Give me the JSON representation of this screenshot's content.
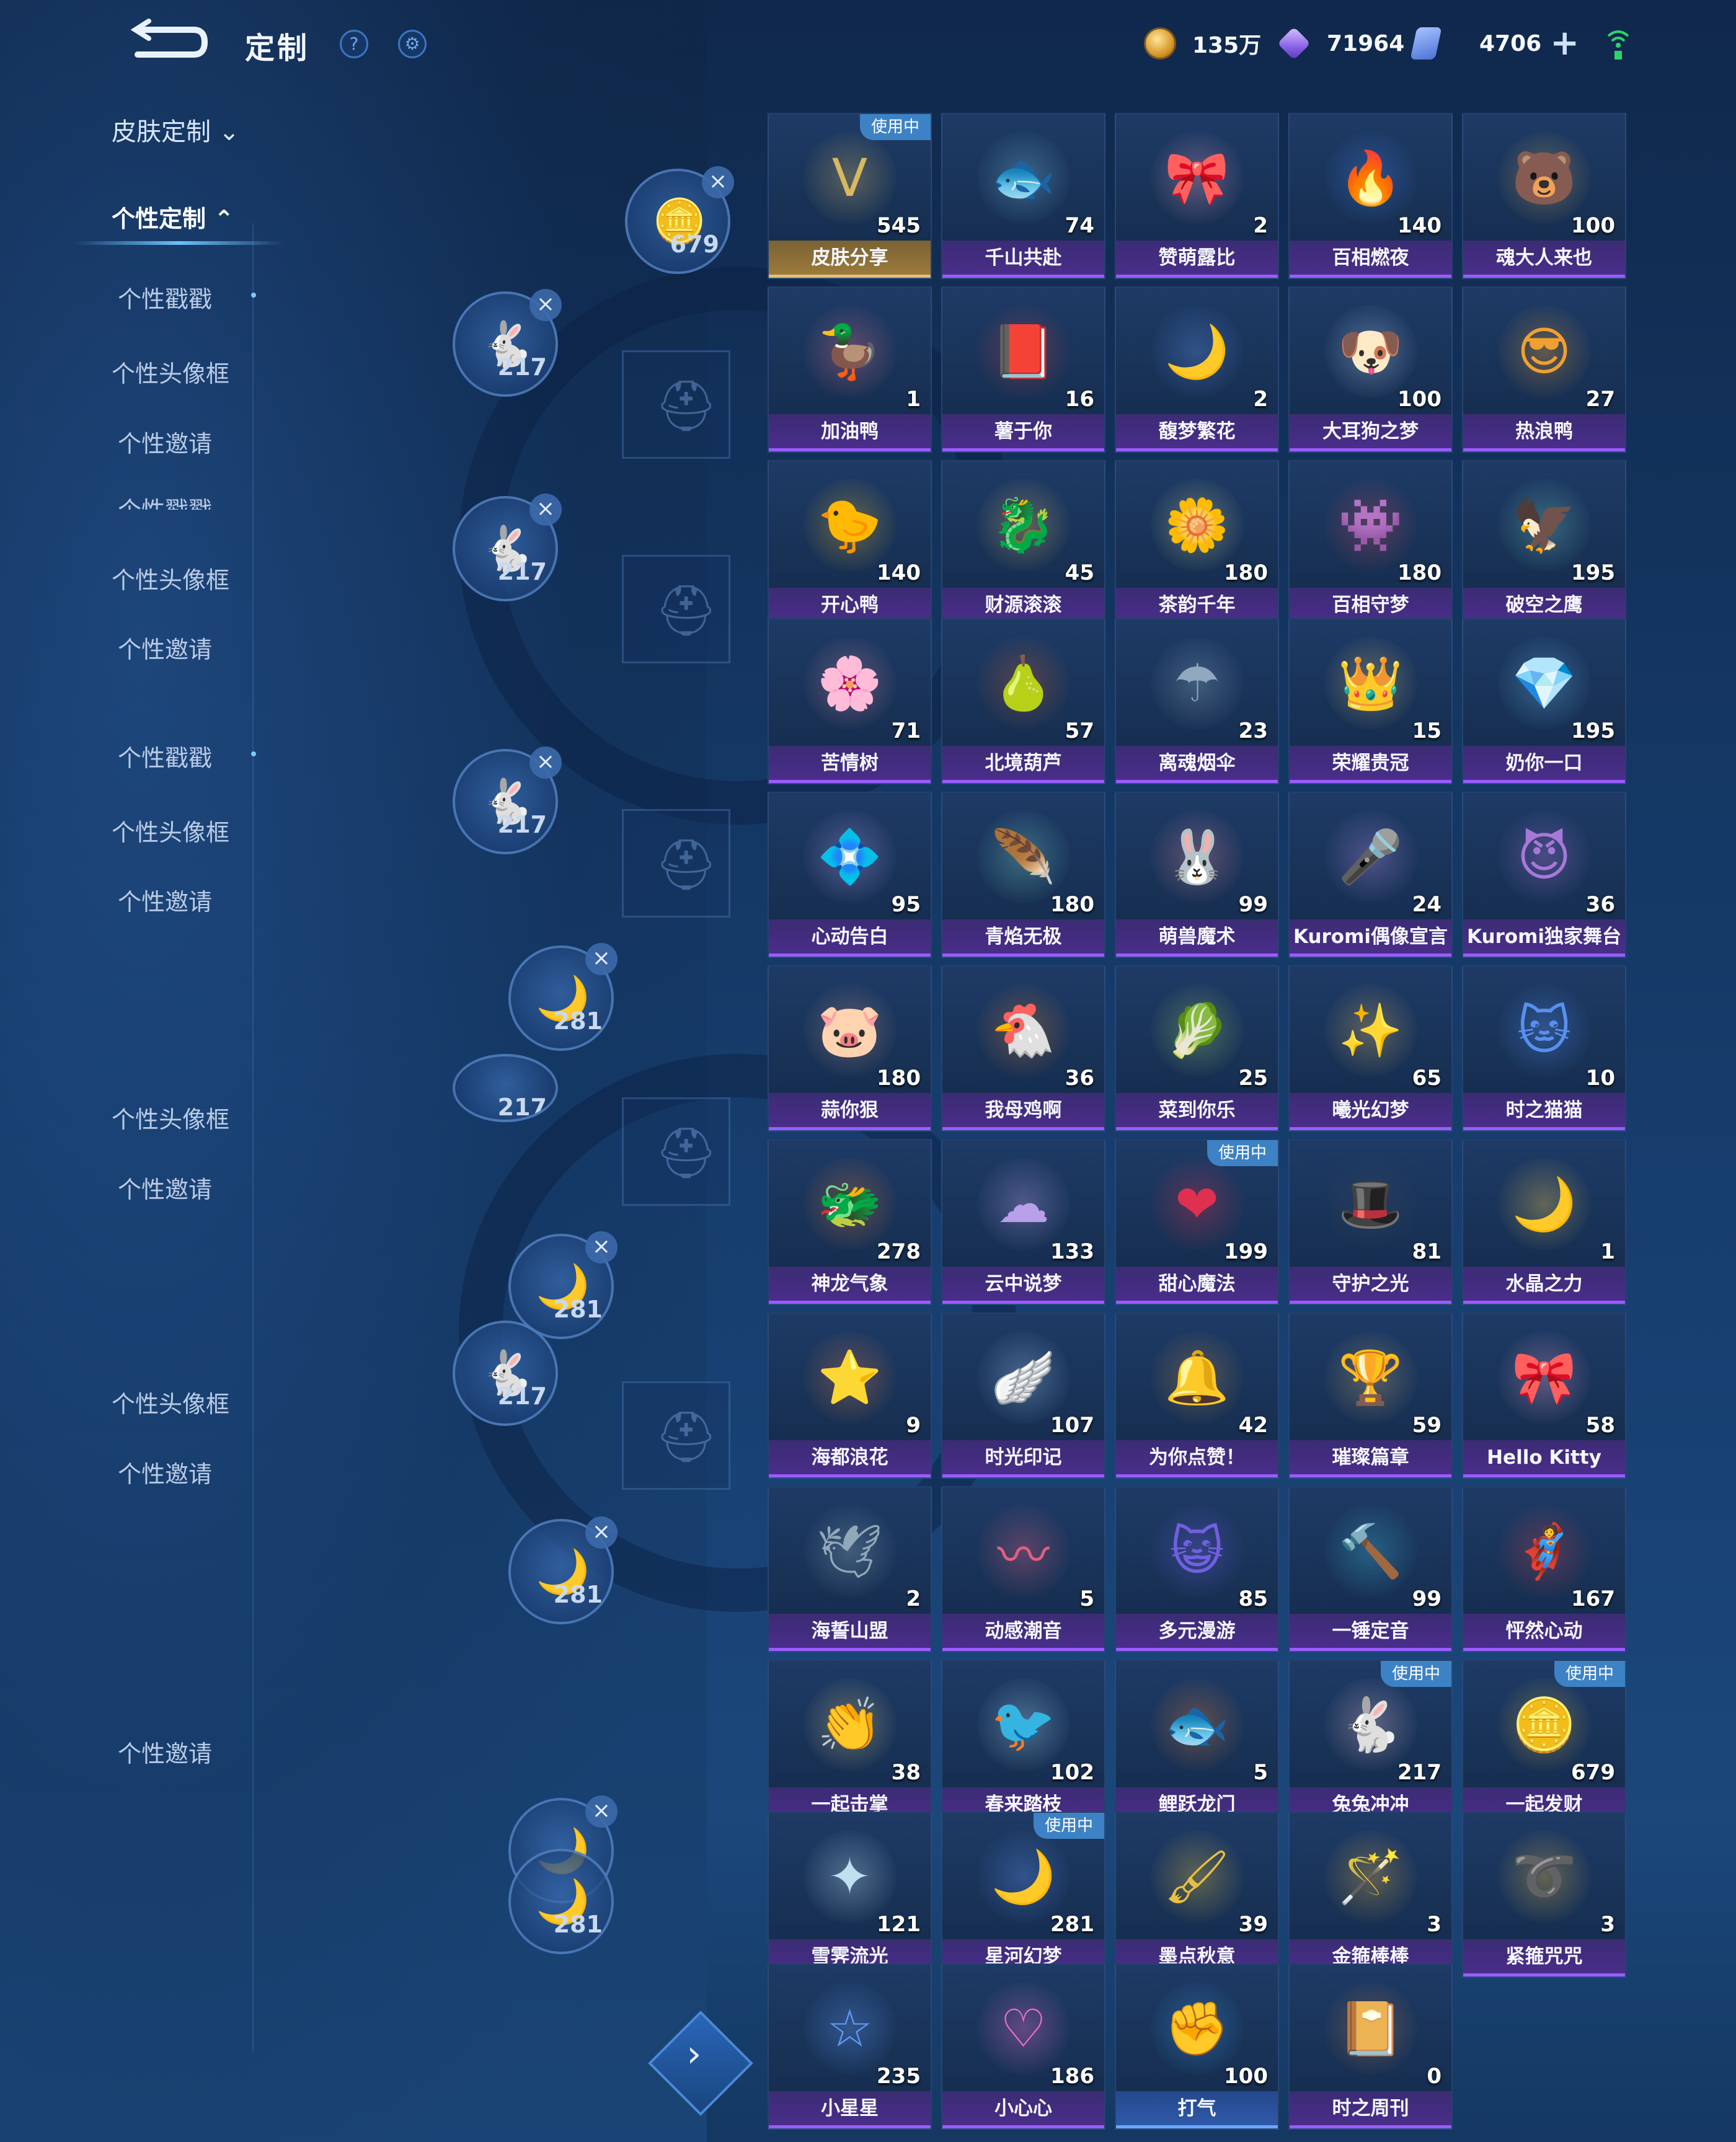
{
  "header": {
    "title": "定制",
    "currencies": [
      {
        "icon": "gold-coin-icon",
        "value": "135万"
      },
      {
        "icon": "purple-gem-icon",
        "value": "71964"
      },
      {
        "icon": "ticket-icon",
        "value": "4706"
      }
    ]
  },
  "sidebar": {
    "section_label": "皮肤定制",
    "items": [
      {
        "label": "个性定制",
        "y": 0
      },
      {
        "label": "个性戳戳"
      },
      {
        "label": "个性头像框"
      },
      {
        "label": "个性邀请"
      },
      {
        "label": "个性戳戳"
      },
      {
        "label": "个性头像框"
      },
      {
        "label": "个性邀请"
      },
      {
        "label": "个性戳戳"
      },
      {
        "label": "个性头像框"
      },
      {
        "label": "个性邀请"
      },
      {
        "label": "个性头像框"
      },
      {
        "label": "个性邀请"
      },
      {
        "label": "个性头像框"
      },
      {
        "label": "个性邀请"
      },
      {
        "label": "个性邀请"
      }
    ]
  },
  "previews": [
    {
      "value": "679"
    },
    {
      "value": "217"
    },
    {
      "value": "217"
    },
    {
      "value": "217"
    },
    {
      "value": "281"
    },
    {
      "value": "217"
    },
    {
      "value": "281"
    },
    {
      "value": "217"
    },
    {
      "value": "281"
    },
    {
      "value": "281"
    },
    {
      "value": "281"
    }
  ],
  "badge_text": "使用中",
  "items": [
    {
      "name": "皮肤分享",
      "count": "545",
      "icon": "V",
      "badge": true,
      "style": "gold",
      "color": "#d8b860"
    },
    {
      "name": "千山共赴",
      "count": "74",
      "icon": "🐟",
      "color": "#7fc6e0"
    },
    {
      "name": "赞萌露比",
      "count": "2",
      "icon": "🎀",
      "color": "#f2a3c4"
    },
    {
      "name": "百相燃夜",
      "count": "140",
      "icon": "🔥",
      "color": "#4e86f0"
    },
    {
      "name": "魂大人来也",
      "count": "100",
      "icon": "🐻",
      "color": "#e6b650"
    },
    {
      "name": "加油鸭",
      "count": "1",
      "icon": "🦆",
      "color": "#f07890"
    },
    {
      "name": "薯于你",
      "count": "16",
      "icon": "📕",
      "color": "#e0404a"
    },
    {
      "name": "馥梦繁花",
      "count": "2",
      "icon": "🌙",
      "color": "#5f8ee8"
    },
    {
      "name": "大耳狗之梦",
      "count": "100",
      "icon": "🐶",
      "color": "#c8daf8"
    },
    {
      "name": "热浪鸭",
      "count": "27",
      "icon": "😎",
      "color": "#f0a030"
    },
    {
      "name": "开心鸭",
      "count": "140",
      "icon": "🐤",
      "color": "#f8c020"
    },
    {
      "name": "财源滚滚",
      "count": "45",
      "icon": "🐉",
      "color": "#e8c060"
    },
    {
      "name": "茶韵千年",
      "count": "180",
      "icon": "🌼",
      "color": "#e8e890"
    },
    {
      "name": "百相守梦",
      "count": "180",
      "icon": "👾",
      "color": "#d84860"
    },
    {
      "name": "破空之鹰",
      "count": "195",
      "icon": "🦅",
      "color": "#7ad0c0"
    },
    {
      "name": "苦情树",
      "count": "71",
      "icon": "🌸",
      "color": "#f08aa8"
    },
    {
      "name": "北境葫芦",
      "count": "57",
      "icon": "🍐",
      "color": "#d06030"
    },
    {
      "name": "离魂烟伞",
      "count": "23",
      "icon": "☂",
      "color": "#90a8c0"
    },
    {
      "name": "荣耀贵冠",
      "count": "15",
      "icon": "👑",
      "color": "#e8c870"
    },
    {
      "name": "奶你一口",
      "count": "195",
      "icon": "💎",
      "color": "#70c0f0"
    },
    {
      "name": "心动告白",
      "count": "95",
      "icon": "💠",
      "color": "#c8a8f8"
    },
    {
      "name": "青焰无极",
      "count": "180",
      "icon": "🪶",
      "color": "#80d8c8"
    },
    {
      "name": "萌兽魔术",
      "count": "99",
      "icon": "🐰",
      "color": "#f08aa0"
    },
    {
      "name": "Kuromi偶像宣言",
      "count": "24",
      "icon": "🎤",
      "color": "#b890e8"
    },
    {
      "name": "Kuromi独家舞台",
      "count": "36",
      "icon": "😈",
      "color": "#a878d8"
    },
    {
      "name": "蒜你狠",
      "count": "180",
      "icon": "🐷",
      "color": "#d8a088"
    },
    {
      "name": "我母鸡啊",
      "count": "36",
      "icon": "🐔",
      "color": "#e88030"
    },
    {
      "name": "菜到你乐",
      "count": "25",
      "icon": "🥬",
      "color": "#a8d860"
    },
    {
      "name": "曦光幻梦",
      "count": "65",
      "icon": "✨",
      "color": "#e8b860"
    },
    {
      "name": "时之猫猫",
      "count": "10",
      "icon": "🐱",
      "color": "#5890f0"
    },
    {
      "name": "神龙气象",
      "count": "278",
      "icon": "🐲",
      "color": "#f07830"
    },
    {
      "name": "云中说梦",
      "count": "133",
      "icon": "☁",
      "color": "#b8a0e8"
    },
    {
      "name": "甜心魔法",
      "count": "199",
      "icon": "❤",
      "badge": true,
      "color": "#e03050"
    },
    {
      "name": "守护之光",
      "count": "81",
      "icon": "🎩",
      "color": "#404858"
    },
    {
      "name": "水晶之力",
      "count": "1",
      "icon": "🌙",
      "color": "#f0c850"
    },
    {
      "name": "海都浪花",
      "count": "9",
      "icon": "⭐",
      "color": "#f08040"
    },
    {
      "name": "时光印记",
      "count": "107",
      "icon": "🪽",
      "color": "#a8c8f0"
    },
    {
      "name": "为你点赞！",
      "count": "42",
      "icon": "🔔",
      "color": "#d09040"
    },
    {
      "name": "璀璨篇章",
      "count": "59",
      "icon": "🏆",
      "color": "#d8b070"
    },
    {
      "name": "Hello Kitty",
      "count": "58",
      "icon": "🎀",
      "color": "#f0a0c8"
    },
    {
      "name": "海誓山盟",
      "count": "2",
      "icon": "🕊",
      "color": "#90a8b8"
    },
    {
      "name": "动感潮音",
      "count": "5",
      "icon": "〰",
      "color": "#e06080"
    },
    {
      "name": "多元漫游",
      "count": "85",
      "icon": "😺",
      "color": "#7060e0"
    },
    {
      "name": "一锤定音",
      "count": "99",
      "icon": "🔨",
      "color": "#40b8d0"
    },
    {
      "name": "怦然心动",
      "count": "167",
      "icon": "🦸",
      "color": "#d04050"
    },
    {
      "name": "一起击掌",
      "count": "38",
      "icon": "👏",
      "color": "#f0d080"
    },
    {
      "name": "春来踏枝",
      "count": "102",
      "icon": "🐦",
      "color": "#b0e0f0"
    },
    {
      "name": "鲤跃龙门",
      "count": "5",
      "icon": "🐟",
      "color": "#f08030"
    },
    {
      "name": "兔兔冲冲",
      "count": "217",
      "icon": "🐇",
      "badge": true,
      "color": "#f0c0d0"
    },
    {
      "name": "一起发财",
      "count": "679",
      "icon": "🪙",
      "badge": true,
      "color": "#f0c040"
    },
    {
      "name": "雪霁流光",
      "count": "121",
      "icon": "✦",
      "color": "#c0e0f0"
    },
    {
      "name": "星河幻梦",
      "count": "281",
      "icon": "🌙",
      "badge": true,
      "color": "#6090f0"
    },
    {
      "name": "墨点秋意",
      "count": "39",
      "icon": "🖌",
      "color": "#e8c040"
    },
    {
      "name": "金箍棒棒",
      "count": "3",
      "icon": "🪄",
      "color": "#e8b040"
    },
    {
      "name": "紧箍咒咒",
      "count": "3",
      "icon": "➰",
      "color": "#f0c040"
    },
    {
      "name": "小星星",
      "count": "235",
      "icon": "☆",
      "color": "#6098f0"
    },
    {
      "name": "小心心",
      "count": "186",
      "icon": "♡",
      "color": "#f070d0"
    },
    {
      "name": "打气",
      "count": "100",
      "icon": "✊",
      "style": "blue",
      "color": "#40a8f0"
    },
    {
      "name": "时之周刊",
      "count": "0",
      "icon": "📔",
      "color": "#d88040"
    }
  ]
}
